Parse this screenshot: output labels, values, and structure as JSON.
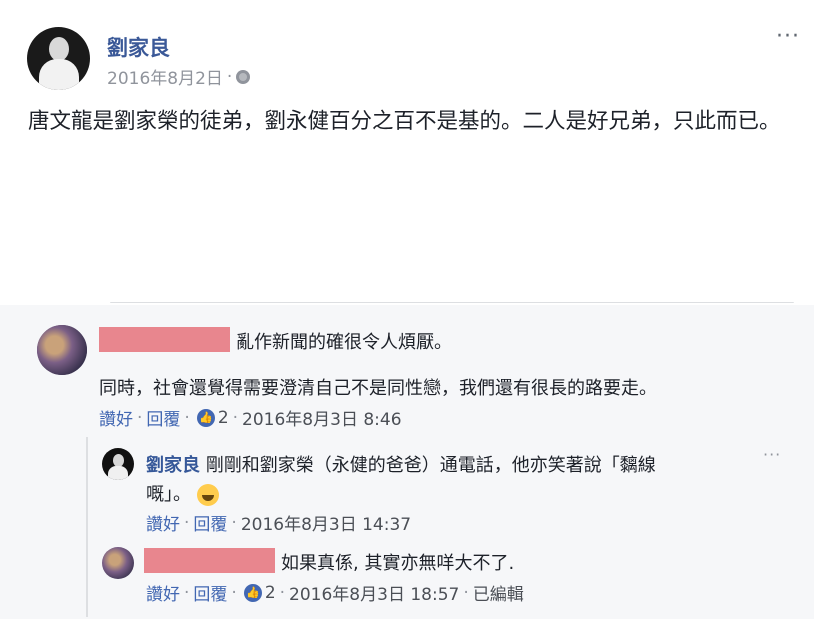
{
  "post": {
    "author": "劉家良",
    "date": "2016年8月2日",
    "dot": "·",
    "more": "···",
    "text": "唐文龍是劉家榮的徒弟，劉永健百分之百不是基的。二人是好兄弟，只此而已。"
  },
  "comments": [
    {
      "text": "亂作新聞的確很令人煩厭。",
      "text2": "同時，社會還覺得需要澄清自己不是同性戀，我們還有很長的路要走。",
      "like_label": "讚好",
      "reply_label": "回覆",
      "like_count": "2",
      "time": "2016年8月3日 8:46"
    }
  ],
  "replies": [
    {
      "author": "劉家良",
      "text": "剛剛和劉家榮（永健的爸爸）通電話，他亦笑著說「黐線",
      "text_line2": "嘅」。",
      "like_label": "讚好",
      "reply_label": "回覆",
      "time": "2016年8月3日 14:37",
      "more": "···"
    },
    {
      "text": "如果真係, 其實亦無咩大不了.",
      "like_label": "讚好",
      "reply_label": "回覆",
      "like_count": "2",
      "time": "2016年8月3日 18:57",
      "edited": "已編輯"
    }
  ],
  "ui": {
    "sep": "·"
  }
}
